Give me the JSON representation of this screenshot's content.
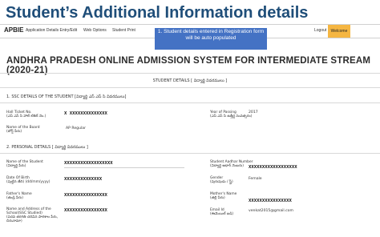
{
  "slide": {
    "title": "Student’s Additional Information details"
  },
  "navbar": {
    "logo": "APBIE",
    "items": [
      "Application Details Entry/Edit",
      "Web Options",
      "Student Print"
    ],
    "logout": "Logout",
    "welcome": "Welcome"
  },
  "callout": {
    "text": "1. Student details entered in Registration form will be auto populated"
  },
  "page": {
    "heading": "ANDHRA PRADESH ONLINE ADMISSION SYSTEM FOR INTERMEDIATE STREAM (2020-21)",
    "student_details": "STUDENT DETAILS [ విద్యార్థి వివరములు ]"
  },
  "ssc": {
    "heading": "1. SSC DETAILS OF THE STUDENT [విద్యార్థి ఎస్ ఎస్ సి వివరములు]",
    "hall_ticket_label": "Hall Ticket No.",
    "hall_ticket_label_te": "(ఎస్ ఎస్ సి హాల్ టికెట్ నెం.)",
    "hall_ticket_value": "X XXXXXXXXXXXXXX",
    "year_label": "Year of Passing",
    "year_label_te": "(ఎస్ ఎస్ సి ఉత్తీర్ణ సంవత్సరం)",
    "year_value": "2017",
    "board_label": "Name of the Board",
    "board_label_te": "(బోర్డ్ పేరు)",
    "board_value": "AP Regular"
  },
  "personal": {
    "heading": "2. PERSONAL DETAILS [ విద్యార్థి వివరములు ]",
    "student_name_label": "Name of the Student",
    "student_name_label_te": "(విద్యార్థి పేరు)",
    "student_name_value": "XXXXXXXXXXXXXXXXXX",
    "aadhar_label": "Student Aadhar Number",
    "aadhar_label_te": "(విద్యార్థి ఆధార్ నెంబరు)",
    "aadhar_value": "XXXXXXXXXXXXXXXXXX",
    "dob_label": "Date Of Birth",
    "dob_label_te": "(పుట్టిన తేది) (dd/mm/yyyy)",
    "dob_value": "XXXXXXXXXXXXXX",
    "gender_label": "Gender",
    "gender_label_te": "(పురుషుడు / స్త్రీ)",
    "gender_value": "Female",
    "father_label": "Father's Name",
    "father_label_te": "(తండ్రి పేరు)",
    "father_value": "XXXXXXXXXXXXXXXX",
    "mother_label": "Mother's Name",
    "mother_label_te": "(తల్లి పేరు)",
    "mother_value": "XXXXXXXXXXXXXXXX",
    "school_label": "Name and Address of the School(SSC Studied)",
    "school_label_te": "(పదవ తరగతి చదివిన పాఠశాల పేరు, చిరునామా)",
    "school_value": "XXXXXXXXXXXXXXXX",
    "email_label": "Email Id",
    "email_label_te": "(ఈమెయిల్ ఐడి)",
    "email_value": "venkat2015@gmail.com"
  }
}
